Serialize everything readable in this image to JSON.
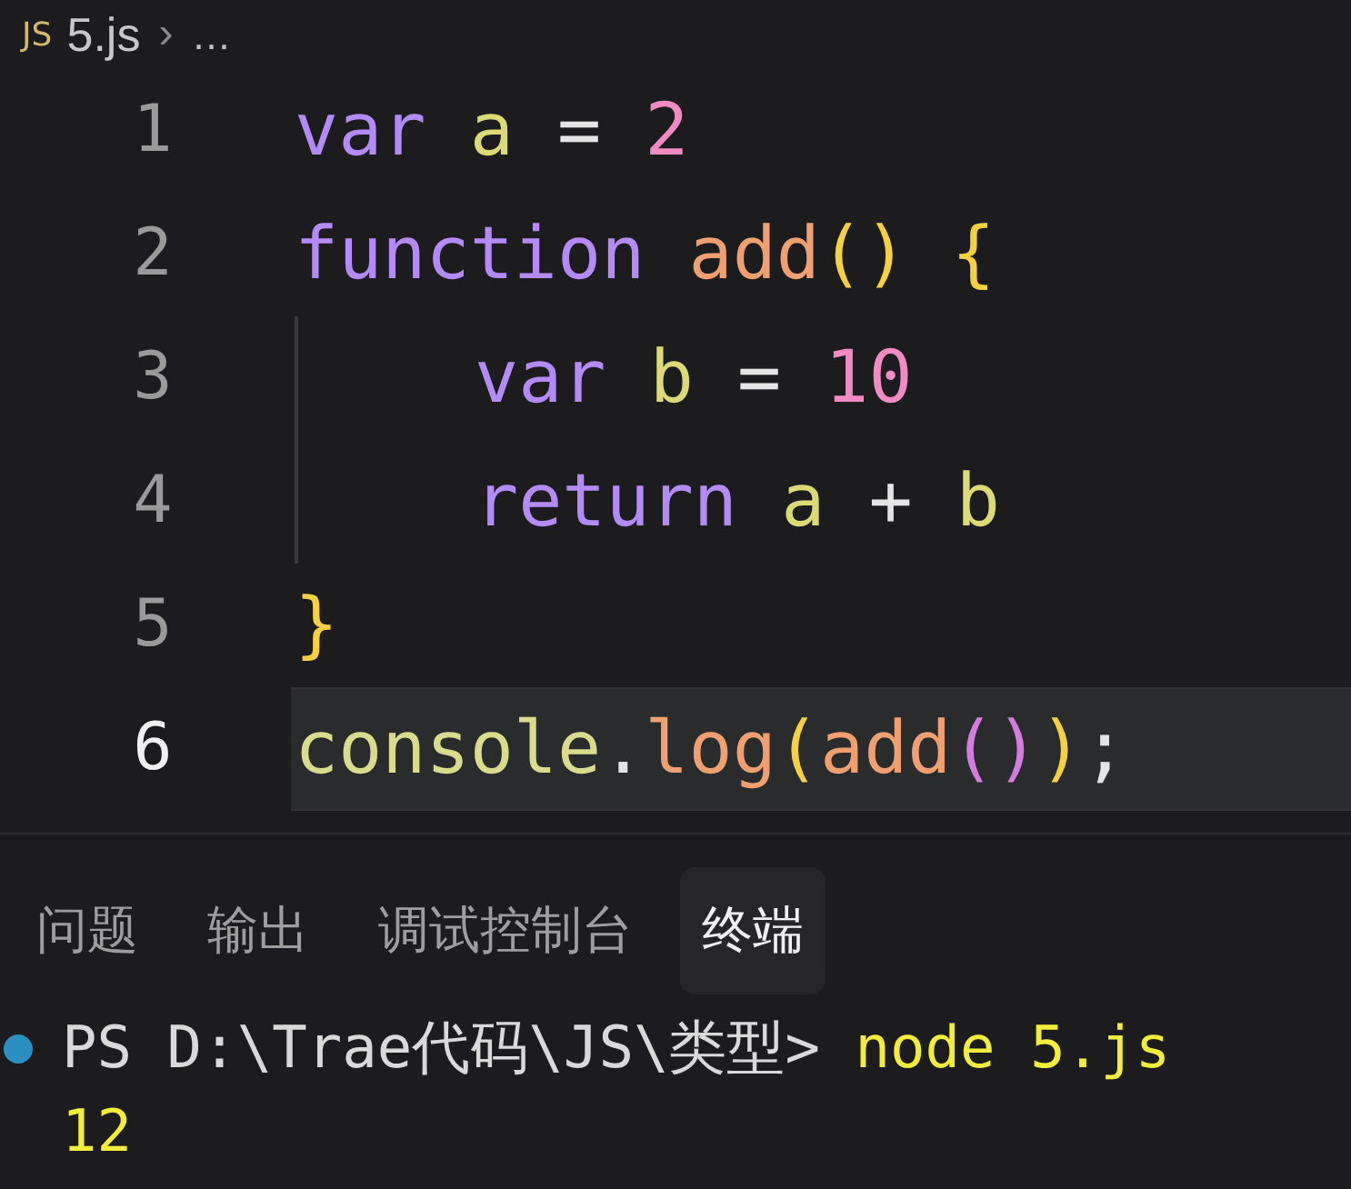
{
  "breadcrumb": {
    "language_badge": "JS",
    "file": "5.js",
    "separator": "›",
    "more": "…"
  },
  "editor": {
    "lines": [
      {
        "number": "1",
        "current": false,
        "indented": false,
        "tokens": [
          {
            "text": "var ",
            "kind": "keyword"
          },
          {
            "text": "a",
            "kind": "variable"
          },
          {
            "text": " = ",
            "kind": "operator"
          },
          {
            "text": "2",
            "kind": "number"
          }
        ]
      },
      {
        "number": "2",
        "current": false,
        "indented": false,
        "tokens": [
          {
            "text": "function ",
            "kind": "keyword"
          },
          {
            "text": "add",
            "kind": "function"
          },
          {
            "text": "() {",
            "kind": "bracket1"
          }
        ]
      },
      {
        "number": "3",
        "current": false,
        "indented": true,
        "tokens": [
          {
            "text": "var ",
            "kind": "keyword"
          },
          {
            "text": "b",
            "kind": "variable"
          },
          {
            "text": " = ",
            "kind": "operator"
          },
          {
            "text": "10",
            "kind": "number"
          }
        ]
      },
      {
        "number": "4",
        "current": false,
        "indented": true,
        "tokens": [
          {
            "text": "return ",
            "kind": "keyword"
          },
          {
            "text": "a",
            "kind": "variable"
          },
          {
            "text": " + ",
            "kind": "operator"
          },
          {
            "text": "b",
            "kind": "variable"
          }
        ]
      },
      {
        "number": "5",
        "current": false,
        "indented": false,
        "tokens": [
          {
            "text": "}",
            "kind": "bracket1"
          }
        ]
      },
      {
        "number": "6",
        "current": true,
        "indented": false,
        "tokens": [
          {
            "text": "console",
            "kind": "object"
          },
          {
            "text": ".",
            "kind": "operator"
          },
          {
            "text": "log",
            "kind": "function"
          },
          {
            "text": "(",
            "kind": "bracket1"
          },
          {
            "text": "add",
            "kind": "function"
          },
          {
            "text": "()",
            "kind": "bracket2"
          },
          {
            "text": ")",
            "kind": "bracket1"
          },
          {
            "text": ";",
            "kind": "operator"
          }
        ]
      }
    ]
  },
  "panel": {
    "tabs": [
      {
        "label": "问题",
        "selected": false
      },
      {
        "label": "输出",
        "selected": false
      },
      {
        "label": "调试控制台",
        "selected": false
      },
      {
        "label": "终端",
        "selected": true
      }
    ],
    "terminal": [
      {
        "kind": "command",
        "prompt": "PS D:\\Trae代码\\JS\\类型>",
        "command": "node 5.js"
      },
      {
        "kind": "output",
        "text": "12"
      }
    ]
  }
}
